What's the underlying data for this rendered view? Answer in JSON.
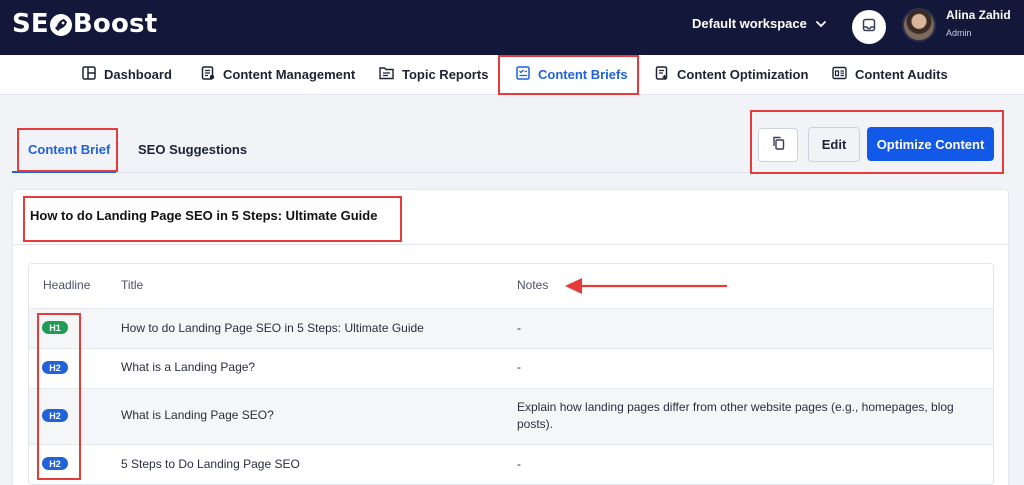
{
  "app": {
    "logo_pre": "SE",
    "logo_post": "Boost",
    "workspace": "Default workspace",
    "user": {
      "name": "Alina Zahid",
      "role": "Admin"
    }
  },
  "nav": [
    {
      "label": "Dashboard",
      "icon": "dashboard-icon"
    },
    {
      "label": "Content Management",
      "icon": "content-management-icon"
    },
    {
      "label": "Topic Reports",
      "icon": "topic-reports-icon"
    },
    {
      "label": "Content Briefs",
      "icon": "content-briefs-icon",
      "active": true
    },
    {
      "label": "Content Optimization",
      "icon": "content-optimization-icon"
    },
    {
      "label": "Content Audits",
      "icon": "content-audits-icon"
    }
  ],
  "tabs": [
    {
      "label": "Content Brief",
      "active": true
    },
    {
      "label": "SEO Suggestions"
    }
  ],
  "actions": {
    "edit": "Edit",
    "optimize": "Optimize Content"
  },
  "brief_title": "How to do Landing Page SEO in 5 Steps: Ultimate Guide",
  "table": {
    "headers": [
      "Headline",
      "Title",
      "Notes"
    ],
    "rows": [
      {
        "tag": "H1",
        "title": "How to do Landing Page SEO in 5 Steps: Ultimate Guide",
        "notes": "-"
      },
      {
        "tag": "H2",
        "title": "What is a Landing Page?",
        "notes": "-"
      },
      {
        "tag": "H2",
        "title": "What is Landing Page SEO?",
        "notes": "Explain how landing pages differ from other website pages (e.g., homepages, blog posts)."
      },
      {
        "tag": "H2",
        "title": "5 Steps to Do Landing Page SEO",
        "notes": "-"
      }
    ]
  },
  "colors": {
    "topbar": "#13183a",
    "accent": "#1f62d9",
    "primary_button": "#1259e8",
    "h1_badge": "#1f9d57",
    "annotation": "#e53b3b"
  }
}
